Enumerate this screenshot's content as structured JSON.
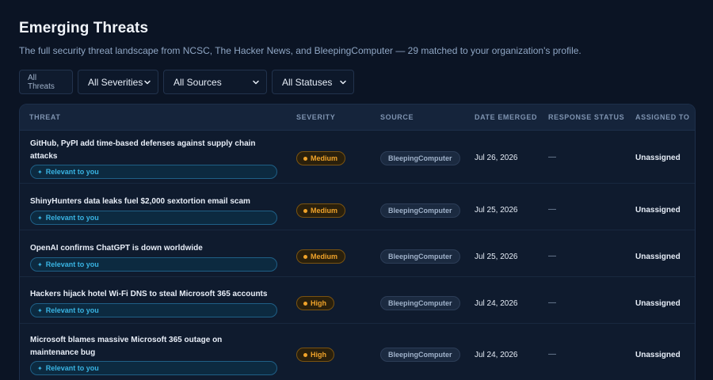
{
  "header": {
    "title": "Emerging Threats",
    "subtitle": "The full security threat landscape from NCSC, The Hacker News, and BleepingComputer — 29 matched to your organization's profile."
  },
  "filters": {
    "all_threats_label": "All Threats",
    "severity_value": "All Severities",
    "source_value": "All Sources",
    "status_value": "All Statuses"
  },
  "table": {
    "columns": {
      "threat": "THREAT",
      "severity": "SEVERITY",
      "source": "SOURCE",
      "date": "DATE EMERGED",
      "status": "RESPONSE STATUS",
      "assigned": "ASSIGNED TO"
    },
    "relevant_label": "Relevant to you",
    "rows": [
      {
        "title": "GitHub, PyPI add time-based defenses against supply chain attacks",
        "severity": "Medium",
        "source": "BleepingComputer",
        "date": "Jul 26, 2026",
        "status": "—",
        "assigned": "Unassigned"
      },
      {
        "title": "ShinyHunters data leaks fuel $2,000 sextortion email scam",
        "severity": "Medium",
        "source": "BleepingComputer",
        "date": "Jul 25, 2026",
        "status": "—",
        "assigned": "Unassigned"
      },
      {
        "title": "OpenAI confirms ChatGPT is down worldwide",
        "severity": "Medium",
        "source": "BleepingComputer",
        "date": "Jul 25, 2026",
        "status": "—",
        "assigned": "Unassigned"
      },
      {
        "title": "Hackers hijack hotel Wi-Fi DNS to steal Microsoft 365 accounts",
        "severity": "High",
        "source": "BleepingComputer",
        "date": "Jul 24, 2026",
        "status": "—",
        "assigned": "Unassigned"
      },
      {
        "title": "Microsoft blames massive Microsoft 365 outage on maintenance bug",
        "severity": "High",
        "source": "BleepingComputer",
        "date": "Jul 24, 2026",
        "status": "—",
        "assigned": "Unassigned"
      }
    ]
  },
  "colors": {
    "background": "#0b1424",
    "severity_accent": "#f0a32a",
    "relevant_accent": "#39b4e3"
  }
}
